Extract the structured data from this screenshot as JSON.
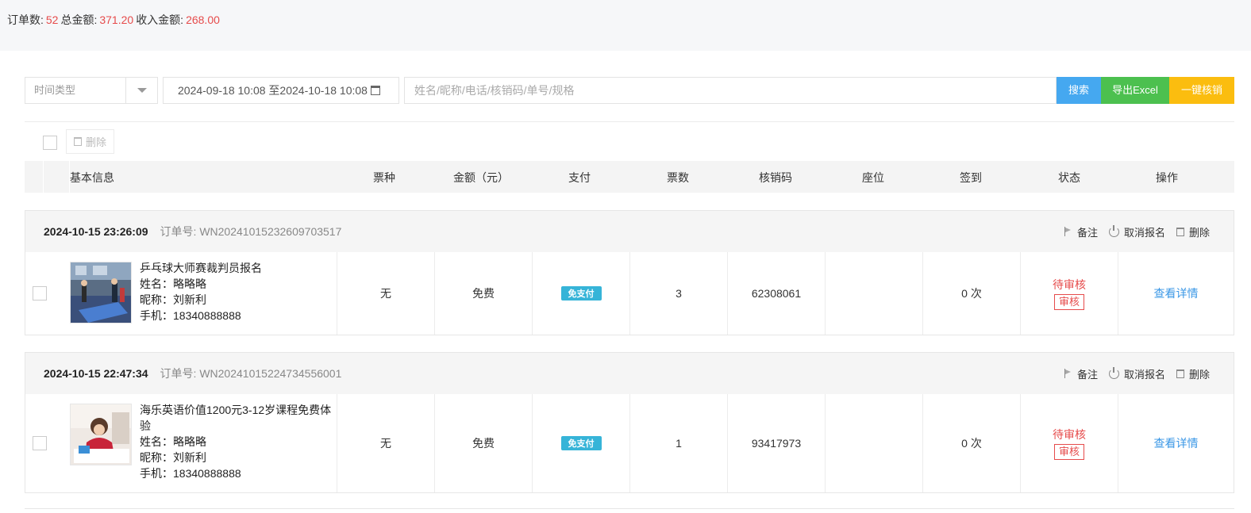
{
  "summary": {
    "order_count_label": "订单数:",
    "order_count": "52",
    "total_label": "总金额:",
    "total": "371.20",
    "income_label": "收入金额:",
    "income": "268.00"
  },
  "filters": {
    "time_type": "时间类型",
    "date_range": "2024-09-18 10:08 至2024-10-18 10:08",
    "search_placeholder": "姓名/昵称/电话/核销码/单号/规格",
    "search_value": "",
    "search_btn": "搜索",
    "excel_btn": "导出Excel",
    "verify_btn": "一键核销"
  },
  "toolbar": {
    "delete_label": "删除"
  },
  "columns": [
    "基本信息",
    "票种",
    "金额（元）",
    "支付",
    "票数",
    "核销码",
    "座位",
    "签到",
    "状态",
    "操作"
  ],
  "order_actions": {
    "note": "备注",
    "cancel": "取消报名",
    "delete": "删除"
  },
  "orders": [
    {
      "time": "2024-10-15 23:26:09",
      "order_no": "订单号: WN20241015232609703517",
      "title": "乒乓球大师赛裁判员报名",
      "name": "姓名：略略略",
      "nickname": "昵称：刘新利",
      "phone": "手机：18340888888",
      "ticket_type": "无",
      "amount": "免费",
      "payment": "免支付",
      "tickets": "3",
      "code": "62308061",
      "seat": "",
      "checkin": "0 次",
      "status": "待审核",
      "audit": "审核",
      "detail": "查看详情"
    },
    {
      "time": "2024-10-15 22:47:34",
      "order_no": "订单号: WN20241015224734556001",
      "title": "海乐英语价值1200元3-12岁课程免费体验",
      "name": "姓名：略略略",
      "nickname": "昵称：刘新利",
      "phone": "手机：18340888888",
      "ticket_type": "无",
      "amount": "免费",
      "payment": "免支付",
      "tickets": "1",
      "code": "93417973",
      "seat": "",
      "checkin": "0 次",
      "status": "待审核",
      "audit": "审核",
      "detail": "查看详情"
    }
  ]
}
